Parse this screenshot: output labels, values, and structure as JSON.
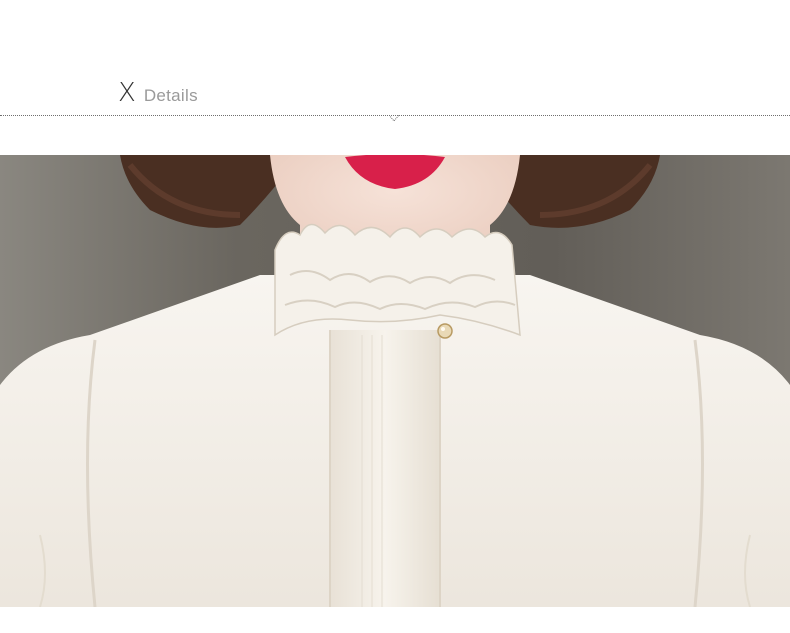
{
  "section": {
    "mark": "X",
    "title": "Details"
  },
  "photo": {
    "subject": "garment-closeup"
  },
  "colors": {
    "background": "#ffffff",
    "title_mark": "#333333",
    "title_text": "#9a9a9a",
    "divider": "#6f6f6f",
    "blouse": "#f4f0ea",
    "backdrop": "#6e6a63",
    "hair": "#4a2f22",
    "lips": "#d8204a"
  }
}
